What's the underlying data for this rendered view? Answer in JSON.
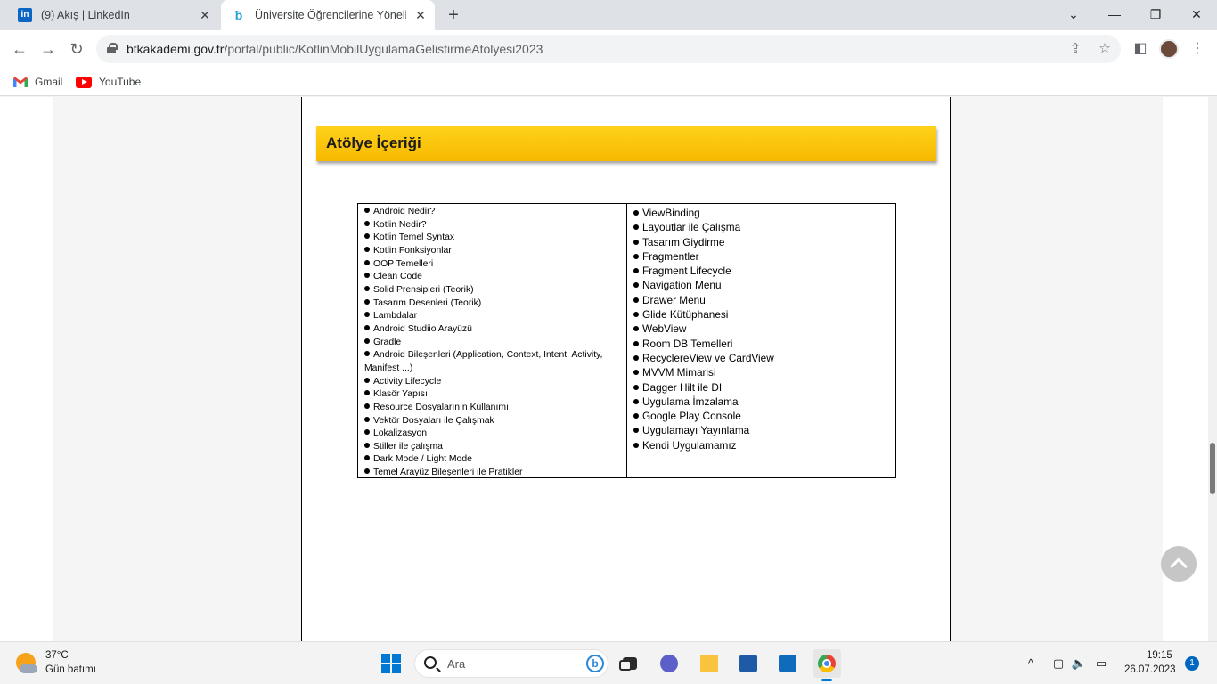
{
  "browser": {
    "tabs": [
      {
        "title": "(9) Akış | LinkedIn",
        "active": false
      },
      {
        "title": "Üniversite Öğrencilerine Yönelik K",
        "active": true
      }
    ],
    "new_tab_label": "+",
    "window_controls": {
      "dropdown": "⌄",
      "minimize": "—",
      "restore": "❐",
      "close": "✕"
    },
    "tab_close_glyph": "✕",
    "nav": {
      "back": "←",
      "forward": "→",
      "reload": "↻"
    },
    "address": {
      "host": "btkakademi.gov.tr",
      "path": "/portal/public/KotlinMobilUygulamaGelistirmeAtolyesi2023"
    },
    "toolbar_icons": {
      "share": "⇪",
      "bookmark_star": "☆",
      "side_panel": "◧",
      "menu": "⋮"
    },
    "bookmarks": [
      {
        "label": "Gmail",
        "icon": "gmail-icon"
      },
      {
        "label": "YouTube",
        "icon": "youtube-icon"
      }
    ]
  },
  "page": {
    "section_title": "Atölye İçeriği",
    "left_items": [
      "Android Nedir?",
      "Kotlin Nedir?",
      "Kotlin Temel Syntax",
      "Kotlin Fonksiyonlar",
      "OOP Temelleri",
      "Clean Code",
      "Solid Prensipleri (Teorik)",
      "Tasarım Desenleri (Teorik)",
      "Lambdalar",
      "Android Studiio Arayüzü",
      "Gradle",
      "Android Bileşenleri (Application, Context, Intent, Activity, Manifest ...)",
      "Activity Lifecycle",
      "Klasör Yapısı",
      "Resource Dosyalarının Kullanımı",
      "Vektör Dosyaları ile Çalışmak",
      "Lokalizasyon",
      "Stiller ile çalışma",
      "Dark Mode / Light Mode",
      "Temel Arayüz Bileşenleri ile Pratikler"
    ],
    "right_items": [
      "ViewBinding",
      "Layoutlar ile Çalışma",
      "Tasarım Giydirme",
      "Fragmentler",
      "Fragment Lifecycle",
      "Navigation Menu",
      "Drawer Menu",
      "Glide Kütüphanesi",
      "WebView",
      "Room DB Temelleri",
      "RecyclereView ve CardView",
      "MVVM Mimarisi",
      "Dagger Hilt ile DI",
      "Uygulama İmzalama",
      "Google Play Console",
      "Uygulamayı Yayınlama",
      "Kendi Uygulamamız"
    ],
    "accent_color": "#ffc107"
  },
  "taskbar": {
    "weather": {
      "temp": "37°C",
      "desc": "Gün batımı"
    },
    "search_placeholder": "Ara",
    "bing_glyph": "b",
    "apps": [
      "task-view",
      "teams-chat",
      "file-explorer",
      "microsoft-store",
      "mail",
      "chrome"
    ],
    "tray": {
      "chevron": "^",
      "network": "▢",
      "volume": "🔈",
      "battery": "▭"
    },
    "clock": {
      "time": "19:15",
      "date": "26.07.2023"
    },
    "notification_count": "1"
  }
}
